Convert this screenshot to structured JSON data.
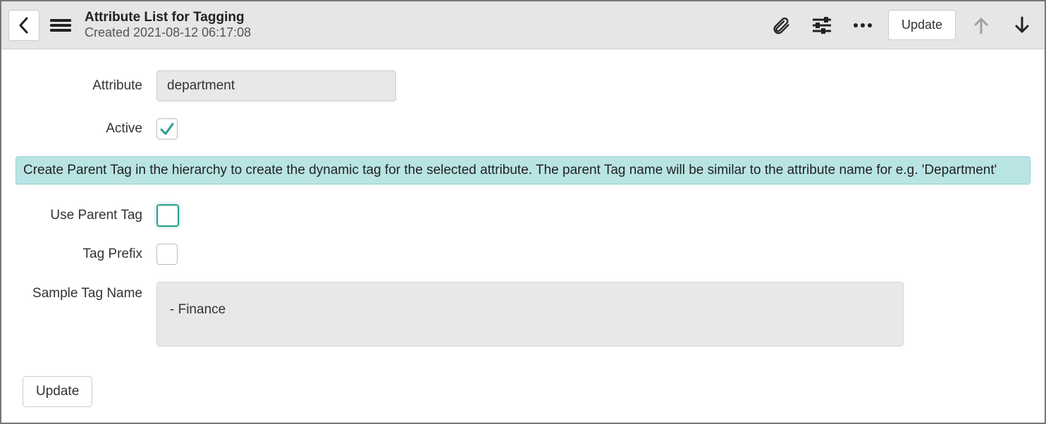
{
  "header": {
    "title": "Attribute List for Tagging",
    "subtitle": "Created 2021-08-12 06:17:08",
    "update_label": "Update"
  },
  "form": {
    "attribute_label": "Attribute",
    "attribute_value": "department",
    "active_label": "Active",
    "active_checked": true,
    "info_text": "Create Parent Tag in the hierarchy to create the dynamic tag for the selected attribute. The parent Tag name will be similar to the attribute name for e.g. 'Department'",
    "use_parent_tag_label": "Use Parent Tag",
    "use_parent_tag_checked": false,
    "tag_prefix_label": "Tag Prefix",
    "tag_prefix_checked": false,
    "sample_tag_name_label": "Sample Tag Name",
    "sample_tag_name_value": "- Finance",
    "update_button_label": "Update"
  }
}
